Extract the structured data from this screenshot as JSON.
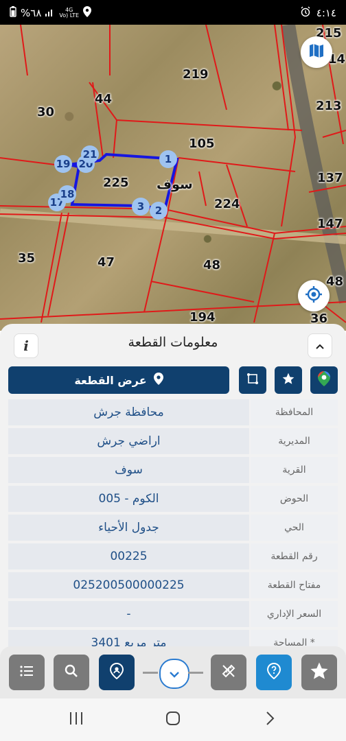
{
  "status_bar": {
    "battery": "%٦٨",
    "network_top": "4G",
    "network_bottom": "Vo) LTE",
    "time": "٤:١٤"
  },
  "map": {
    "village_label": "سوف",
    "parcels": [
      "215",
      "14",
      "219",
      "44",
      "30",
      "213",
      "105",
      "137",
      "225",
      "224",
      "147",
      "35",
      "47",
      "48",
      "48",
      "194",
      "36"
    ],
    "vertices": [
      "1",
      "2",
      "3",
      "17",
      "18",
      "19",
      "20",
      "21"
    ],
    "icons": [
      "map-layers-icon",
      "my-location-icon"
    ]
  },
  "panel": {
    "title": "معلومات القطعة",
    "info_label": "i",
    "show_parcel_label": "عرض القطعة",
    "rows": [
      {
        "label": "المحافظة",
        "value": "محافظة جرش"
      },
      {
        "label": "المديرية",
        "value": "اراضي جرش"
      },
      {
        "label": "القرية",
        "value": "سوف"
      },
      {
        "label": "الحوض",
        "value": "الكوم - 005"
      },
      {
        "label": "الحي",
        "value": "جدول الأحياء"
      },
      {
        "label": "رقم القطعة",
        "value": "00225"
      },
      {
        "label": "مفتاح القطعة",
        "value": "025200500000225"
      },
      {
        "label": "السعر الإداري",
        "value": "-"
      },
      {
        "label": "المساحة *",
        "value": "3401 متر مربع"
      }
    ]
  },
  "colors": {
    "navy": "#10406e",
    "accent_blue": "#1f8ad1",
    "parcel_lines": "#e01919",
    "selection": "#1616e0"
  }
}
